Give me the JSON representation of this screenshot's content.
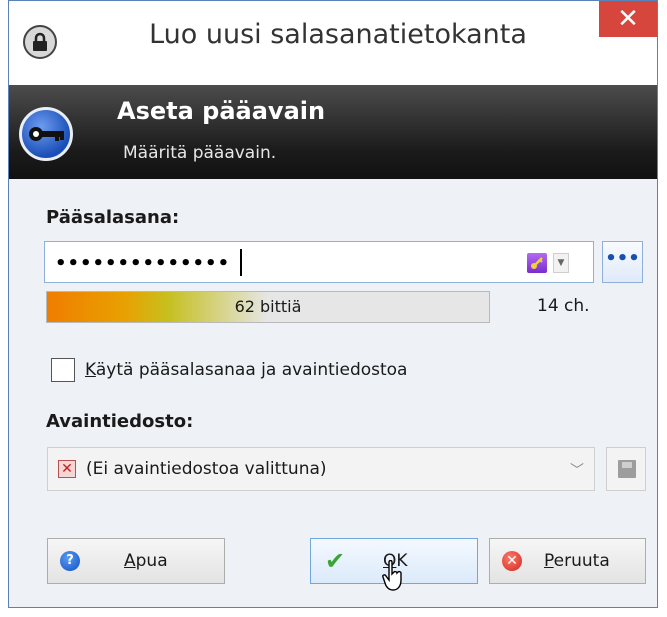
{
  "window": {
    "title": "Luo uusi salasanatietokanta",
    "close_symbol": "✕"
  },
  "banner": {
    "title": "Aseta pääavain",
    "subtitle": "Määritä pääavain."
  },
  "master_password": {
    "label": "Pääsalasana:",
    "value": "••••••••••••••",
    "reveal_button": "•••"
  },
  "strength": {
    "label": "62 bittiä",
    "level_fraction": 0.5,
    "char_count": "14 ch."
  },
  "use_keyfile": {
    "checked": false,
    "label_accel": "K",
    "label_rest": "äytä pääsalasanaa ja avaintiedostoa"
  },
  "keyfile": {
    "label": "Avaintiedosto:",
    "selected": "(Ei avaintiedostoa valittuna)",
    "dropdown_symbol": "﹀"
  },
  "buttons": {
    "help_accel": "A",
    "help_rest": "pua",
    "ok_accel": "O",
    "ok_rest": "K",
    "cancel_accel": "P",
    "cancel_rest": "eruuta"
  },
  "icons": {
    "app": "lock-icon",
    "banner": "key-icon",
    "keyfile_status": "x-icon",
    "save": "disk-icon",
    "help": "help-icon",
    "ok": "check-icon",
    "cancel": "cancel-icon"
  },
  "colors": {
    "close_button": "#d6463c",
    "accent": "#1a4fb0",
    "strength_start": "#f07d00"
  }
}
